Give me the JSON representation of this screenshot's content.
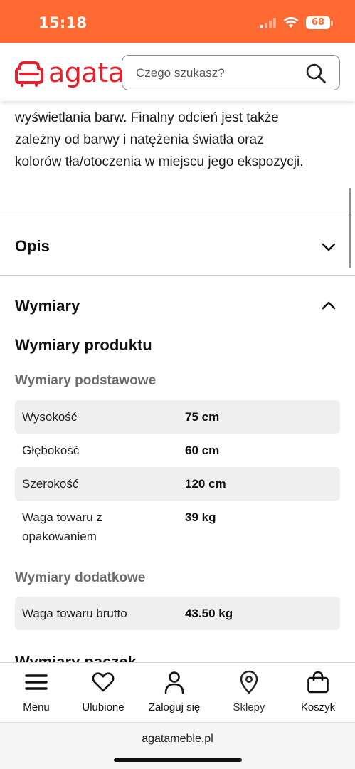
{
  "status_bar": {
    "time": "15:18",
    "battery": "68",
    "background": "#ff6a33"
  },
  "header": {
    "logo_text": "agata",
    "search_placeholder": "Czego szukasz?",
    "brand_color": "#e4202c"
  },
  "description": {
    "text": "wyświetlania barw. Finalny odcień jest także zależny od barwy i natężenia światła oraz kolorów tła/otoczenia w miejscu jego ekspozycji."
  },
  "accordion": {
    "opis": {
      "title": "Opis",
      "expanded": false,
      "icon": "chevron-down-icon"
    },
    "wymiary": {
      "title": "Wymiary",
      "expanded": true,
      "icon": "chevron-up-icon"
    }
  },
  "dimensions": {
    "title": "Wymiary produktu",
    "basic": {
      "heading": "Wymiary podstawowe",
      "rows": [
        {
          "label": "Wysokość",
          "value": "75 cm"
        },
        {
          "label": "Głębokość",
          "value": "60 cm"
        },
        {
          "label": "Szerokość",
          "value": "120 cm"
        },
        {
          "label": "Waga towaru z opakowaniem",
          "value": "39 kg"
        }
      ]
    },
    "extra": {
      "heading": "Wymiary dodatkowe",
      "rows": [
        {
          "label": "Waga towaru brutto",
          "value": "43.50 kg"
        }
      ]
    },
    "packages_heading": "Wymiary paczek"
  },
  "bottom_nav": {
    "items": [
      {
        "label": "Menu",
        "icon": "menu-icon"
      },
      {
        "label": "Ulubione",
        "icon": "heart-icon"
      },
      {
        "label": "Zaloguj się",
        "icon": "user-icon"
      },
      {
        "label": "Sklepy",
        "icon": "location-pin-icon"
      },
      {
        "label": "Koszyk",
        "icon": "shopping-bag-icon"
      }
    ]
  },
  "browser": {
    "url": "agatameble.pl"
  }
}
